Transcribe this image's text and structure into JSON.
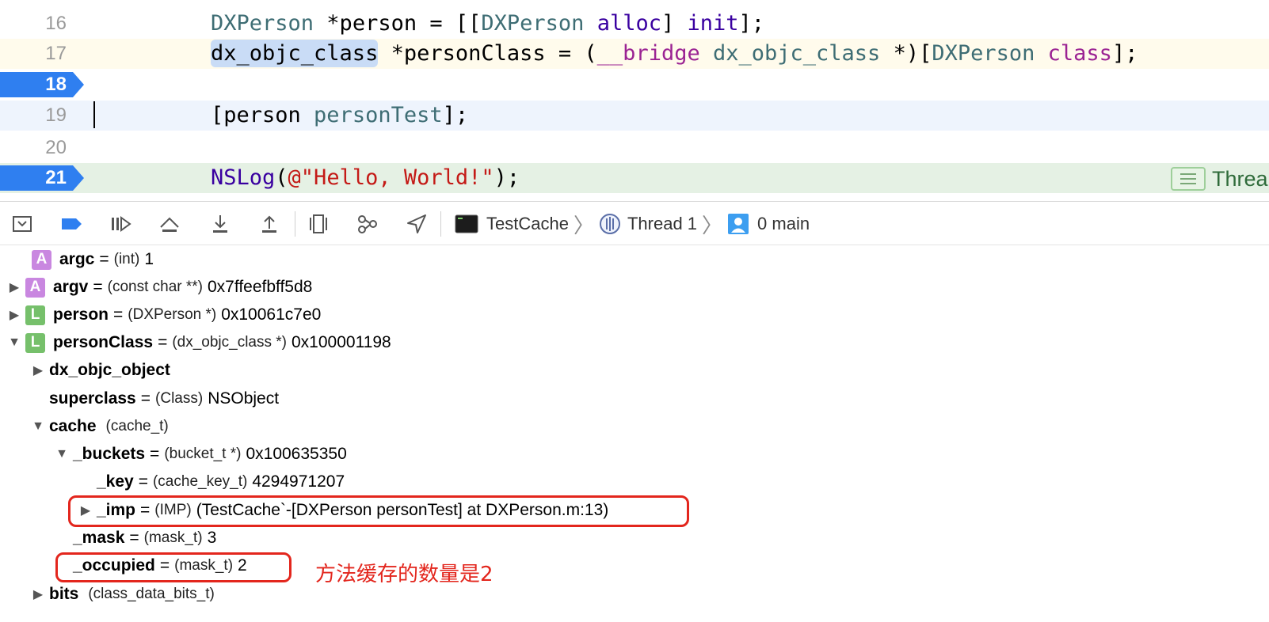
{
  "editor": {
    "lines": [
      {
        "num": "16",
        "segments": [
          {
            "cls": "t-type",
            "text": "DXPerson"
          },
          {
            "cls": "t-plain",
            "text": " *person = [["
          },
          {
            "cls": "t-type",
            "text": "DXPerson"
          },
          {
            "cls": "t-plain",
            "text": " "
          },
          {
            "cls": "t-func",
            "text": "alloc"
          },
          {
            "cls": "t-plain",
            "text": "] "
          },
          {
            "cls": "t-func",
            "text": "init"
          },
          {
            "cls": "t-plain",
            "text": "];"
          }
        ]
      },
      {
        "num": "17",
        "segments": [
          {
            "cls": "t-plain hl-word",
            "text": "dx_objc_class"
          },
          {
            "cls": "t-plain",
            "text": " *personClass = ("
          },
          {
            "cls": "t-kw",
            "text": "__bridge"
          },
          {
            "cls": "t-plain",
            "text": " "
          },
          {
            "cls": "t-type",
            "text": "dx_objc_class"
          },
          {
            "cls": "t-plain",
            "text": " *)["
          },
          {
            "cls": "t-type",
            "text": "DXPerson"
          },
          {
            "cls": "t-plain",
            "text": " "
          },
          {
            "cls": "t-kw",
            "text": "class"
          },
          {
            "cls": "t-plain",
            "text": "];"
          }
        ]
      },
      {
        "num": "18",
        "segments": []
      },
      {
        "num": "19",
        "segments": [
          {
            "cls": "t-plain",
            "text": "[person "
          },
          {
            "cls": "t-msg",
            "text": "personTest"
          },
          {
            "cls": "t-plain",
            "text": "];"
          }
        ]
      },
      {
        "num": "20",
        "segments": []
      },
      {
        "num": "21",
        "segments": [
          {
            "cls": "t-func",
            "text": "NSLog"
          },
          {
            "cls": "t-plain",
            "text": "("
          },
          {
            "cls": "t-str",
            "text": "@\"Hello, World!\""
          },
          {
            "cls": "t-plain",
            "text": ");"
          }
        ]
      }
    ],
    "thread_badge": "Threa"
  },
  "toolbar": {
    "breadcrumb": {
      "process": "TestCache",
      "thread": "Thread 1",
      "frame": "0 main"
    }
  },
  "variables": [
    {
      "disc": "",
      "badge": "A",
      "badge_kind": "arg",
      "name": "argc",
      "eq": "=",
      "type": "(int)",
      "value": "1"
    },
    {
      "disc": "▶",
      "badge": "A",
      "badge_kind": "arg",
      "name": "argv",
      "eq": "=",
      "type": "(const char **)",
      "value": "0x7ffeefbff5d8"
    },
    {
      "disc": "▶",
      "badge": "L",
      "badge_kind": "loc",
      "name": "person",
      "eq": "=",
      "type": "(DXPerson *)",
      "value": "0x10061c7e0"
    },
    {
      "disc": "▼",
      "badge": "L",
      "badge_kind": "loc",
      "name": "personClass",
      "eq": "=",
      "type": "(dx_objc_class *)",
      "value": "0x100001198"
    },
    {
      "disc": "▶",
      "badge": "",
      "name": "dx_objc_object",
      "eq": "",
      "type": "",
      "value": ""
    },
    {
      "disc": "",
      "badge": "",
      "name": "superclass",
      "eq": "=",
      "type": "(Class)",
      "value": "NSObject"
    },
    {
      "disc": "▼",
      "badge": "",
      "name": "cache",
      "eq": "",
      "type": "(cache_t)",
      "value": ""
    },
    {
      "disc": "▼",
      "badge": "",
      "name": "_buckets",
      "eq": "=",
      "type": "(bucket_t *)",
      "value": "0x100635350"
    },
    {
      "disc": "",
      "badge": "",
      "name": "_key",
      "eq": "=",
      "type": "(cache_key_t)",
      "value": "4294971207"
    },
    {
      "disc": "▶",
      "badge": "",
      "name": "_imp",
      "eq": "=",
      "type": "(IMP)",
      "value": "(TestCache`-[DXPerson personTest] at DXPerson.m:13)"
    },
    {
      "disc": "",
      "badge": "",
      "name": "_mask",
      "eq": "=",
      "type": "(mask_t)",
      "value": "3"
    },
    {
      "disc": "",
      "badge": "",
      "name": "_occupied",
      "eq": "=",
      "type": "(mask_t)",
      "value": "2"
    },
    {
      "disc": "▶",
      "badge": "",
      "name": "bits",
      "eq": "",
      "type": "(class_data_bits_t)",
      "value": ""
    }
  ],
  "annotation": {
    "text": "方法缓存的数量是2",
    "color": "#e3261d"
  },
  "colors": {
    "breakpoint": "#2f7ff0",
    "arg_badge": "#c987e0",
    "local_badge": "#76c06b"
  }
}
